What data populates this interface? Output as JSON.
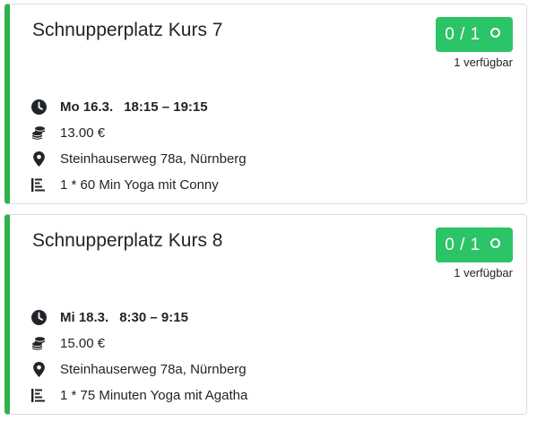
{
  "courses": [
    {
      "title": "Schnupperplatz Kurs 7",
      "booked": "0 / 1",
      "availability": "1 verfügbar",
      "date": "Mo 16.3.",
      "time": "18:15 – 19:15",
      "price": "13.00 €",
      "location": "Steinhauserweg 78a, Nürnberg",
      "description": "1 * 60 Min Yoga mit Conny"
    },
    {
      "title": "Schnupperplatz Kurs 8",
      "booked": "0 / 1",
      "availability": "1 verfügbar",
      "date": "Mi 18.3.",
      "time": "8:30 – 9:15",
      "price": "15.00 €",
      "location": "Steinhauserweg 78a, Nürnberg",
      "description": "1 * 75 Minuten Yoga mit Agatha"
    }
  ],
  "icons": {
    "time": "clock-icon",
    "price": "coins-icon",
    "location": "map-marker-icon",
    "description": "text-align-icon",
    "badge": "ring-icon"
  },
  "colors": {
    "accent": "#2bb24c",
    "badge": "#2bc466"
  }
}
